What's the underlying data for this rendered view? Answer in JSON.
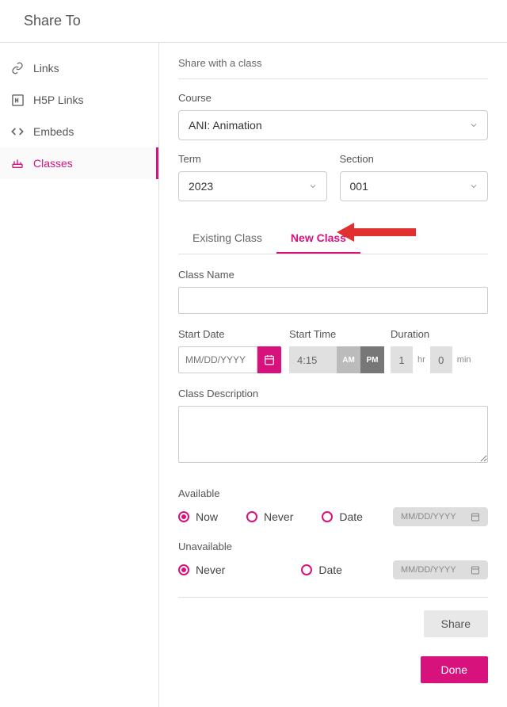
{
  "header": {
    "title": "Share To"
  },
  "sidebar": {
    "items": [
      {
        "label": "Links"
      },
      {
        "label": "H5P Links"
      },
      {
        "label": "Embeds"
      },
      {
        "label": "Classes"
      }
    ]
  },
  "main": {
    "section_title": "Share with a class",
    "course_label": "Course",
    "course_value": "ANI: Animation",
    "term_label": "Term",
    "term_value": "2023",
    "section_label": "Section",
    "section_value": "001",
    "tabs": [
      {
        "label": "Existing Class"
      },
      {
        "label": "New Class"
      }
    ],
    "class_name_label": "Class Name",
    "start_date_label": "Start Date",
    "start_date_placeholder": "MM/DD/YYYY",
    "start_time_label": "Start Time",
    "start_time_value": "4:15",
    "ampm_am": "AM",
    "ampm_pm": "PM",
    "duration_label": "Duration",
    "duration_hr_value": "1",
    "duration_hr_label": "hr",
    "duration_min_value": "0",
    "duration_min_label": "min",
    "class_desc_label": "Class Description",
    "available_label": "Available",
    "available_options": {
      "now": "Now",
      "never": "Never",
      "date": "Date"
    },
    "unavailable_label": "Unavailable",
    "unavailable_options": {
      "never": "Never",
      "date": "Date"
    },
    "date_placeholder": "MM/DD/YYYY",
    "share_button": "Share",
    "done_button": "Done"
  }
}
